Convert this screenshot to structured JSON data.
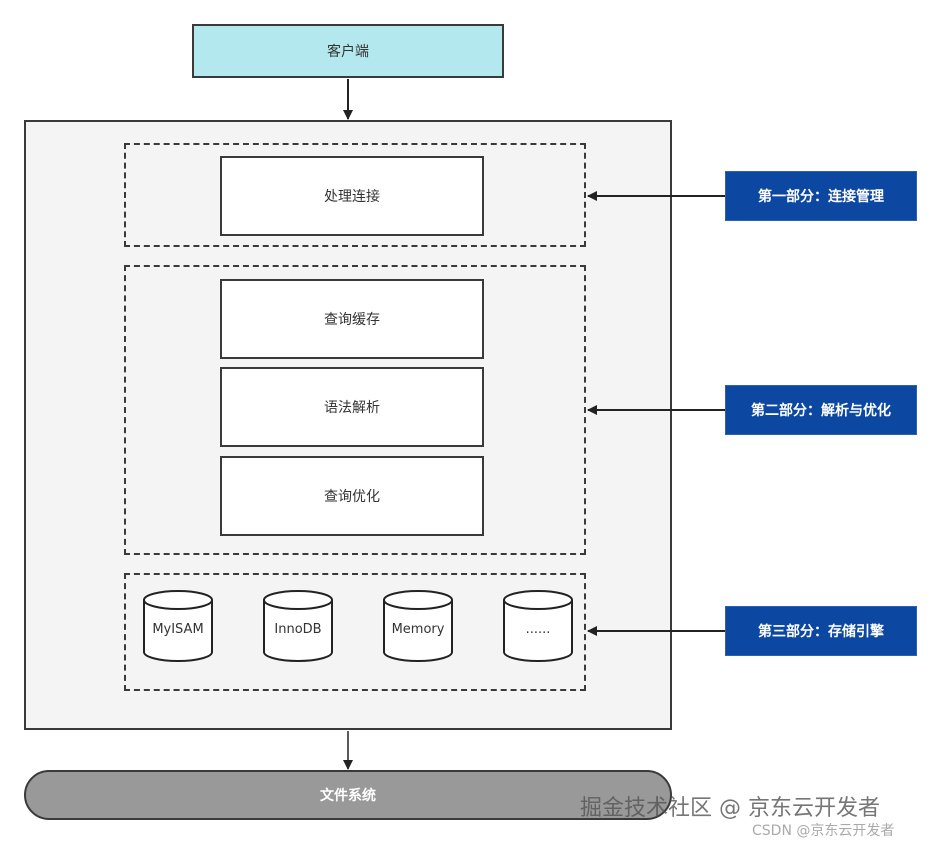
{
  "client": {
    "label": "客户端"
  },
  "connection": {
    "process_label": "处理连接"
  },
  "parsing": {
    "steps": [
      "查询缓存",
      "语法解析",
      "查询优化"
    ]
  },
  "storage": {
    "engines": [
      "MyISAM",
      "InnoDB",
      "Memory",
      "......"
    ]
  },
  "filesystem": {
    "label": "文件系统"
  },
  "parts": [
    {
      "label": "第一部分：连接管理"
    },
    {
      "label": "第二部分：解析与优化"
    },
    {
      "label": "第三部分：存储引擎"
    }
  ],
  "colors": {
    "client_fill": "#b2e8ee",
    "part_label_fill": "#0c47a1",
    "filesystem_fill": "#999999",
    "server_fill": "#f4f4f4"
  },
  "watermark": {
    "primary": "掘金技术社区 @ 京东云开发者",
    "secondary": "CSDN @京东云开发者"
  }
}
